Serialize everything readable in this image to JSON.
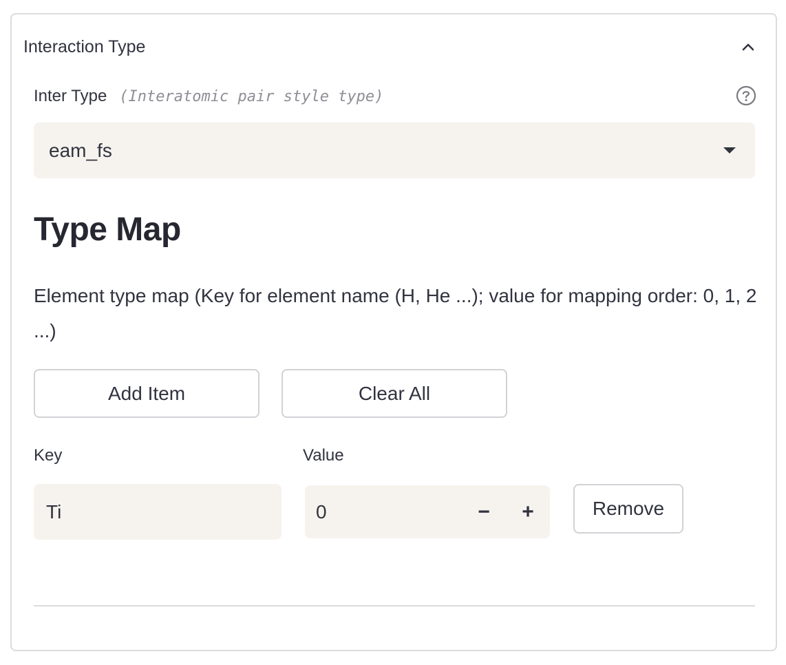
{
  "expander": {
    "title": "Interaction Type"
  },
  "inter_type": {
    "label": "Inter Type",
    "hint": "(Interatomic pair style type)",
    "selected": "eam_fs"
  },
  "type_map": {
    "title": "Type Map",
    "description": "Element type map (Key for element name (H, He ...); value for mapping order: 0, 1, 2 ...)",
    "add_label": "Add Item",
    "clear_label": "Clear All",
    "key_label": "Key",
    "value_label": "Value",
    "rows": [
      {
        "key": "Ti",
        "value": "0",
        "remove_label": "Remove"
      }
    ],
    "minus": "−",
    "plus": "+"
  }
}
